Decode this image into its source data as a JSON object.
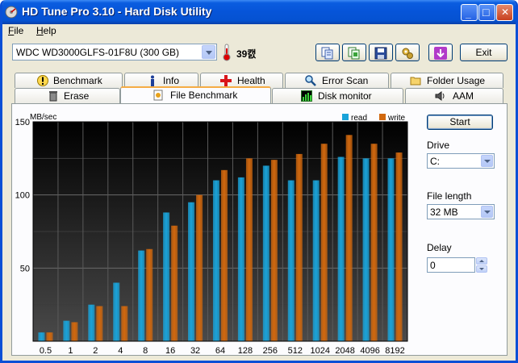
{
  "window": {
    "title": "HD Tune Pro 3.10 - Hard Disk Utility",
    "minimize_glyph": "_",
    "maximize_glyph": "□",
    "close_glyph": "✕"
  },
  "menu": [
    {
      "key": "F",
      "rest": "ile"
    },
    {
      "key": "H",
      "rest": "elp"
    }
  ],
  "toolbar": {
    "drive": "WDC WD3000GLFS-01F8U (300 GB)",
    "temperature": "39캜",
    "buttons": [
      "copy-text-icon",
      "copy-screenshot-icon",
      "save-icon",
      "options-icon",
      "download-icon"
    ],
    "exit_label": "Exit"
  },
  "tabs_row1": [
    "Benchmark",
    "Info",
    "Health",
    "Error Scan",
    "Folder Usage"
  ],
  "tabs_row2": [
    "Erase",
    "File Benchmark",
    "Disk monitor",
    "AAM"
  ],
  "active_tab": "File Benchmark",
  "controls": {
    "start_label": "Start",
    "drive_label": "Drive",
    "drive_value": "C:",
    "file_length_label": "File length",
    "file_length_value": "32 MB",
    "delay_label": "Delay",
    "delay_value": "0"
  },
  "chart_data": {
    "type": "bar",
    "ylabel": "MB/sec",
    "ylim": [
      0,
      150
    ],
    "yticks": [
      50,
      100,
      150
    ],
    "grid": true,
    "legend_position": "top-right",
    "categories": [
      "0.5",
      "1",
      "2",
      "4",
      "8",
      "16",
      "32",
      "64",
      "128",
      "256",
      "512",
      "1024",
      "2048",
      "4096",
      "8192"
    ],
    "series": [
      {
        "name": "read",
        "color": "#1aa3d9",
        "values": [
          6,
          14,
          25,
          40,
          62,
          88,
          95,
          110,
          112,
          120,
          110,
          110,
          126,
          125,
          125
        ]
      },
      {
        "name": "write",
        "color": "#d1680e",
        "values": [
          6,
          13,
          24,
          24,
          63,
          79,
          100,
          117,
          125,
          124,
          128,
          135,
          141,
          135,
          129
        ]
      }
    ],
    "background": "#0a0a0a"
  }
}
